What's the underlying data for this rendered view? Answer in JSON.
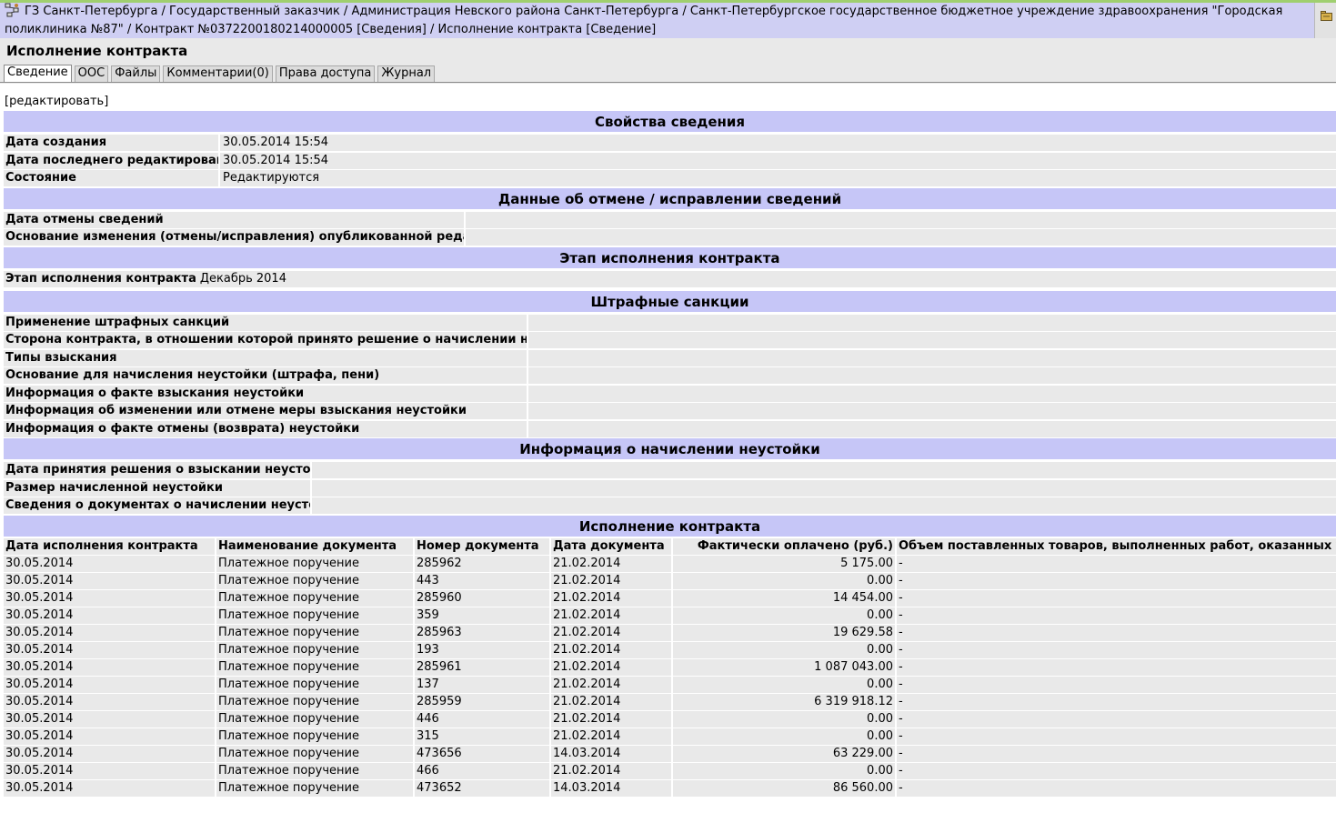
{
  "breadcrumb": {
    "text": "ГЗ Санкт-Петербурга / Государственный заказчик / Администрация Невского района Санкт-Петербурга / Санкт-Петербургское государственное бюджетное учреждение здравоохранения \"Городская поликлиника №87\" / Контракт №0372200180214000005 [Сведения] / Исполнение контракта [Сведение]"
  },
  "page": {
    "title": "Исполнение контракта",
    "edit_link": "[редактировать]"
  },
  "tabs": [
    "Сведение",
    "ООС",
    "Файлы",
    "Комментарии(0)",
    "Права доступа",
    "Журнал"
  ],
  "properties": {
    "title": "Свойства сведения",
    "rows": [
      {
        "label": "Дата создания",
        "value": "30.05.2014 15:54"
      },
      {
        "label": "Дата последнего редактирования",
        "value": "30.05.2014 15:54"
      },
      {
        "label": "Состояние",
        "value": "Редактируются"
      }
    ]
  },
  "cancellation": {
    "title": "Данные об отмене / исправлении сведений",
    "rows": [
      {
        "label": "Дата отмены сведений",
        "value": ""
      },
      {
        "label": "Основание изменения (отмены/исправления) опубликованной редакции",
        "value": ""
      }
    ]
  },
  "stage": {
    "title": "Этап исполнения контракта",
    "label": "Этап исполнения контракта",
    "value": "Декабрь 2014"
  },
  "penalties": {
    "title": "Штрафные санкции",
    "rows": [
      {
        "label": "Применение штрафных санкций",
        "value": ""
      },
      {
        "label": "Сторона контракта, в отношении которой принято решение о начислении неустойки",
        "value": ""
      },
      {
        "label": "Типы взыскания",
        "value": ""
      },
      {
        "label": "Основание для начисления неустойки (штрафа, пени)",
        "value": ""
      },
      {
        "label": "Информация о факте взыскания неустойки",
        "value": ""
      },
      {
        "label": "Информация об изменении или отмене меры взыскания неустойки",
        "value": ""
      },
      {
        "label": "Информация о факте отмены (возврата) неустойки",
        "value": ""
      }
    ]
  },
  "penalty_accrual": {
    "title": "Информация о начислении неустойки",
    "rows": [
      {
        "label": "Дата принятия решения о взыскании неустойки",
        "value": ""
      },
      {
        "label": "Размер начисленной неустойки",
        "value": ""
      },
      {
        "label": "Сведения о документах о начислении неустойки",
        "value": ""
      }
    ]
  },
  "execution": {
    "title": "Исполнение контракта",
    "columns": [
      "Дата исполнения контракта",
      "Наименование документа",
      "Номер документа",
      "Дата документа",
      "Фактически оплачено (руб.)",
      "Объем поставленных товаров, выполненных работ, оказанных услуг"
    ],
    "rows": [
      [
        "30.05.2014",
        "Платежное поручение",
        "285962",
        "21.02.2014",
        "5 175.00",
        "-"
      ],
      [
        "30.05.2014",
        "Платежное поручение",
        "443",
        "21.02.2014",
        "0.00",
        "-"
      ],
      [
        "30.05.2014",
        "Платежное поручение",
        "285960",
        "21.02.2014",
        "14 454.00",
        "-"
      ],
      [
        "30.05.2014",
        "Платежное поручение",
        "359",
        "21.02.2014",
        "0.00",
        "-"
      ],
      [
        "30.05.2014",
        "Платежное поручение",
        "285963",
        "21.02.2014",
        "19 629.58",
        "-"
      ],
      [
        "30.05.2014",
        "Платежное поручение",
        "193",
        "21.02.2014",
        "0.00",
        "-"
      ],
      [
        "30.05.2014",
        "Платежное поручение",
        "285961",
        "21.02.2014",
        "1 087 043.00",
        "-"
      ],
      [
        "30.05.2014",
        "Платежное поручение",
        "137",
        "21.02.2014",
        "0.00",
        "-"
      ],
      [
        "30.05.2014",
        "Платежное поручение",
        "285959",
        "21.02.2014",
        "6 319 918.12",
        "-"
      ],
      [
        "30.05.2014",
        "Платежное поручение",
        "446",
        "21.02.2014",
        "0.00",
        "-"
      ],
      [
        "30.05.2014",
        "Платежное поручение",
        "315",
        "21.02.2014",
        "0.00",
        "-"
      ],
      [
        "30.05.2014",
        "Платежное поручение",
        "473656",
        "14.03.2014",
        "63 229.00",
        "-"
      ],
      [
        "30.05.2014",
        "Платежное поручение",
        "466",
        "21.02.2014",
        "0.00",
        "-"
      ],
      [
        "30.05.2014",
        "Платежное поручение",
        "473652",
        "14.03.2014",
        "86 560.00",
        "-"
      ]
    ]
  }
}
